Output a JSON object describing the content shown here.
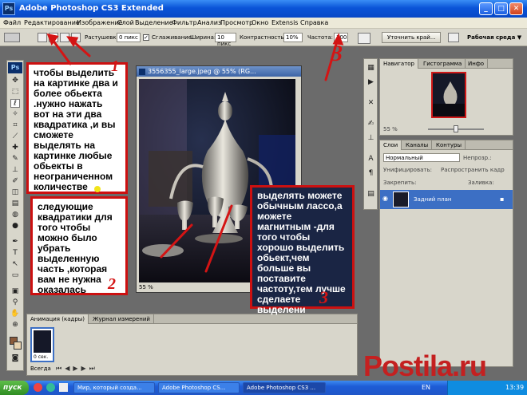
{
  "window": {
    "title": "Adobe Photoshop CS3 Extended",
    "min": "_",
    "max": "□",
    "close": "✕"
  },
  "menu": [
    "Файл",
    "Редактирование",
    "Изображение",
    "Слой",
    "Выделение",
    "Фильтр",
    "Анализ",
    "Просмотр",
    "Окно",
    "Extensis",
    "Справка"
  ],
  "options": {
    "feather_label": "Растушевка:",
    "feather_value": "0 пикс",
    "antialias_label": "Сглаживание",
    "width_label": "Ширина:",
    "width_value": "10 пикс",
    "contrast_label": "Контрастность:",
    "contrast_value": "10%",
    "frequency_label": "Частота:",
    "frequency_value": "100",
    "refine_label": "Уточнить край...",
    "workspace_label": "Рабочая среда ▼"
  },
  "document": {
    "title": "3556355_large.jpeg @ 55% (RG...",
    "zoom": "55 %"
  },
  "notes": {
    "note1": "чтобы выделить на картинке два и более обьекта .нужно нажать вот на эти два квадратика ,и вы сможете выделять на картинке любые обьекты в неограниченном количестве",
    "note2": "следующие квадратики для того чтобы можно было убрать выделенную часть ,которая вам не нужна оказалась",
    "note3": "выделять можете обычным лассо,а можете магнитным -для того чтобы хорошо выделить обьект,чем больше вы поставите частоту,тем лучше сделаете выделени",
    "num1": "1",
    "num2": "2",
    "num3": "3",
    "num3b": "3"
  },
  "navigator": {
    "tabs": [
      "Навигатор",
      "Гистограмма",
      "Инфо"
    ],
    "zoom": "55 %"
  },
  "layers": {
    "tabs": [
      "Слои",
      "Каналы",
      "Контуры"
    ],
    "blend_mode": "Нормальный",
    "opacity_label": "Непрозр.:",
    "lock_label": "Закрепить:",
    "fill_label": "Заливка:",
    "unify_label": "Унифицировать:",
    "propagate_label": "Распространить кадр",
    "layer_name": "Задний план"
  },
  "animation": {
    "tabs": [
      "Анимация (кадры)",
      "Журнал измерений"
    ],
    "frame_label": "0 сек.",
    "loop": "Всегда"
  },
  "taskbar": {
    "start": "пуск",
    "items": [
      "Мир, который созда...",
      "Adobe Photoshop CS...",
      "Adobe Photoshop CS3 ..."
    ],
    "lang": "EN",
    "time": "13:39"
  },
  "watermark": "Postila.ru",
  "colors": {
    "title_blue": "#0a54d8",
    "note_red": "#cc1010",
    "layer_selected": "#3c6fc4"
  }
}
